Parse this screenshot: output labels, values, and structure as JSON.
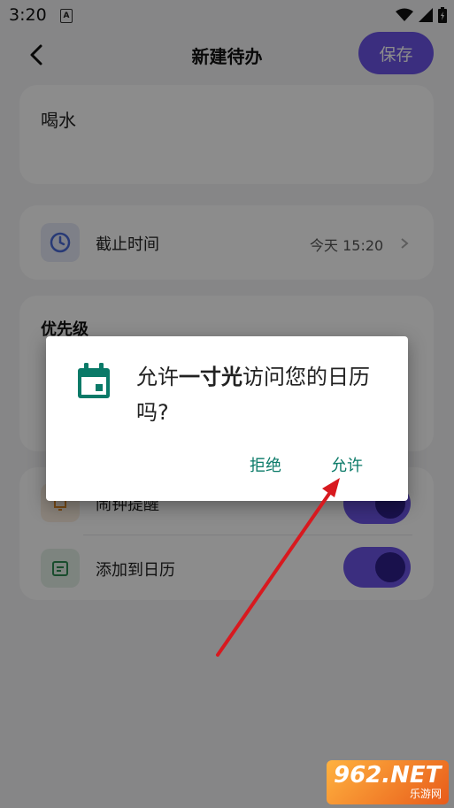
{
  "status_bar": {
    "time": "3:20",
    "notification_letter": "A"
  },
  "header": {
    "title": "新建待办",
    "save_label": "保存"
  },
  "todo": {
    "text": "喝水"
  },
  "deadline": {
    "label": "截止时间",
    "value": "今天 15:20"
  },
  "priority": {
    "title": "优先级"
  },
  "reminders": [
    {
      "label": "闹钟提醒",
      "enabled": true
    },
    {
      "label": "添加到日历",
      "enabled": true
    }
  ],
  "dialog": {
    "message_prefix": "允许",
    "app_name": "一寸光",
    "message_suffix": "访问您的日历吗?",
    "deny_label": "拒绝",
    "allow_label": "允许"
  },
  "watermark": {
    "brand": "962.NET",
    "sub": "乐游网"
  },
  "colors": {
    "accent": "#6c55e8",
    "dialog_button": "#0a7a68",
    "calendar_icon": "#0a7a68"
  },
  "icons": [
    "back-arrow-icon",
    "clock-icon",
    "chevron-right-icon",
    "bell-icon",
    "calendar-icon",
    "wifi-icon",
    "signal-icon",
    "battery-icon"
  ]
}
